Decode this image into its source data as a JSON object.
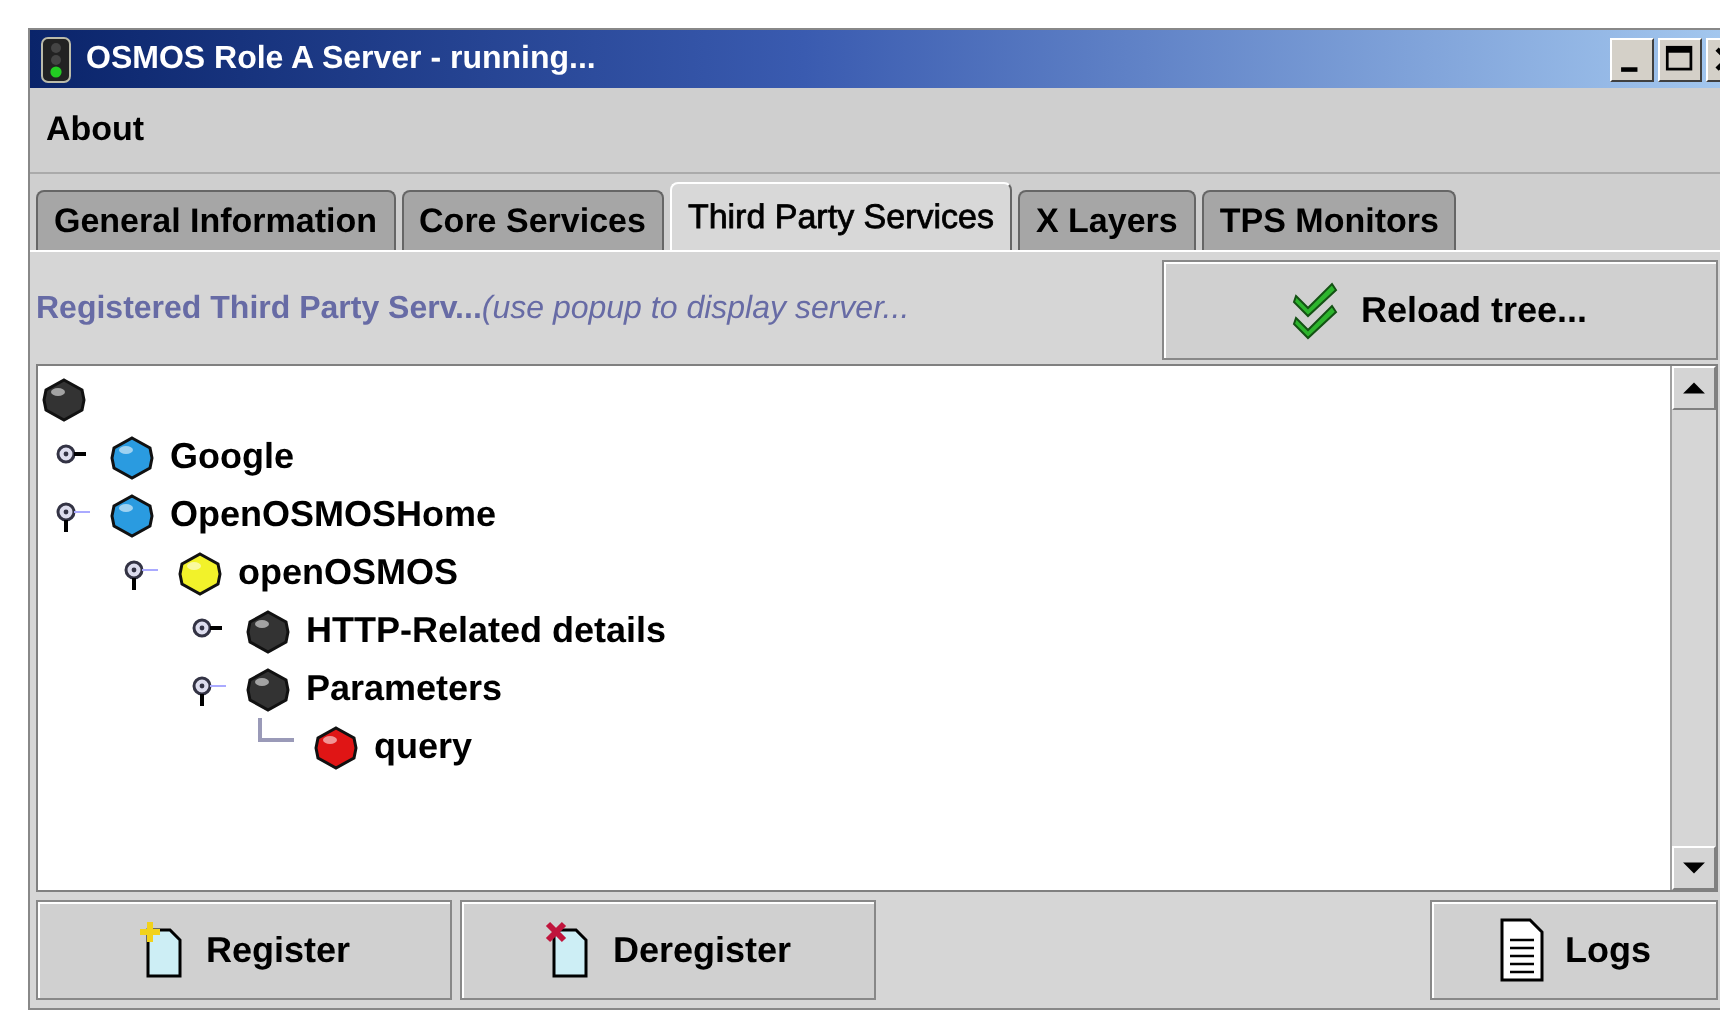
{
  "window": {
    "title": "OSMOS Role A Server - running..."
  },
  "menu": [
    {
      "label": "About"
    }
  ],
  "tabs": [
    {
      "label": "General Information",
      "selected": false
    },
    {
      "label": "Core Services",
      "selected": false
    },
    {
      "label": "Third Party Services",
      "selected": true
    },
    {
      "label": "X Layers",
      "selected": false
    },
    {
      "label": "TPS Monitors",
      "selected": false
    }
  ],
  "header": {
    "title": "Registered Third Party Serv...",
    "hint": "(use popup to display server...",
    "reload_button": "Reload tree..."
  },
  "tree": {
    "color": "#333333",
    "children": [
      {
        "label": "Google",
        "color": "#2a9be0",
        "kind": "branch",
        "expanded": false
      },
      {
        "label": "OpenOSMOSHome",
        "color": "#2a9be0",
        "kind": "branch",
        "expanded": true,
        "children": [
          {
            "label": "openOSMOS",
            "color": "#f2f22a",
            "kind": "branch",
            "expanded": true,
            "children": [
              {
                "label": "HTTP-Related details",
                "color": "#333333",
                "kind": "branch",
                "expanded": false
              },
              {
                "label": "Parameters",
                "color": "#333333",
                "kind": "branch",
                "expanded": true,
                "children": [
                  {
                    "label": "query",
                    "color": "#e01515",
                    "kind": "leaf"
                  }
                ]
              }
            ]
          }
        ]
      }
    ]
  },
  "buttons": [
    {
      "label": "Register",
      "kind": "register"
    },
    {
      "label": "Deregister",
      "kind": "deregister"
    },
    {
      "label": "Logs",
      "kind": "logs"
    }
  ]
}
